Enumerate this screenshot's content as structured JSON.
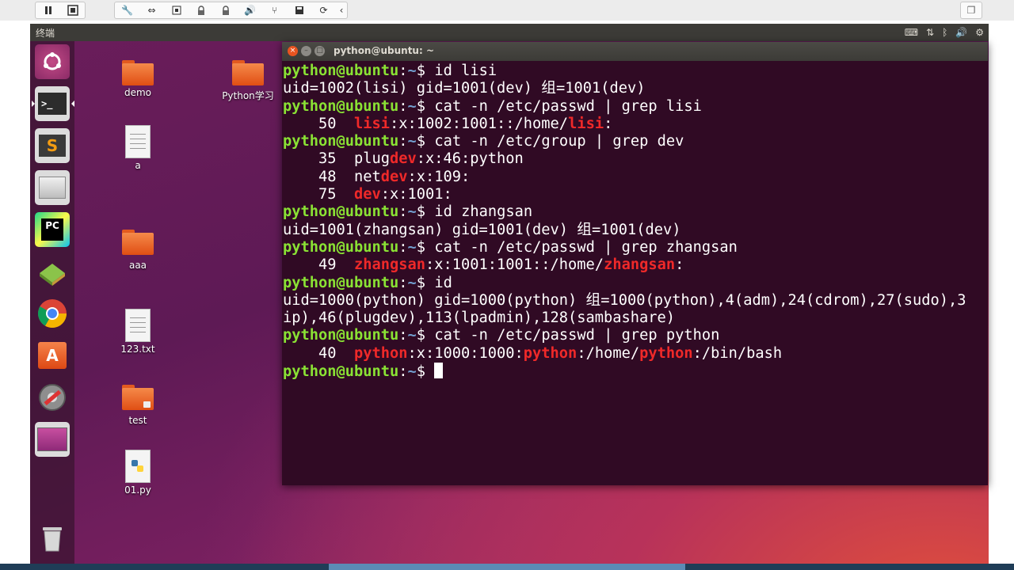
{
  "vm_toolbar": {
    "buttons": [
      "pause",
      "snapshot",
      "settings",
      "connect",
      "keyboard",
      "lock1",
      "lock2",
      "volume",
      "usb",
      "save",
      "refresh",
      "collapse"
    ]
  },
  "top_panel": {
    "title": "终端",
    "indicators": [
      "keyboard-icon",
      "network-icon",
      "bluetooth-icon",
      "volume-icon",
      "settings-icon"
    ]
  },
  "launcher": {
    "items": [
      "ubuntu-dash",
      "terminal",
      "sublime-text",
      "files",
      "pycharm",
      "books",
      "chrome",
      "software-center",
      "system-settings",
      "workspace-switcher",
      "trash"
    ]
  },
  "desktop_icons": [
    {
      "label": "demo",
      "type": "folder"
    },
    {
      "label": "Python学习",
      "type": "folder"
    },
    {
      "label": "a",
      "type": "document"
    },
    {
      "label": "aaa",
      "type": "folder"
    },
    {
      "label": "123.txt",
      "type": "document"
    },
    {
      "label": "test",
      "type": "folder-locked"
    },
    {
      "label": "01.py",
      "type": "python-file"
    }
  ],
  "terminal": {
    "title": "python@ubuntu: ~",
    "prompt_user": "python@ubuntu",
    "prompt_path": "~",
    "lines": [
      {
        "kind": "cmd",
        "text": "id lisi"
      },
      {
        "kind": "out",
        "segments": [
          {
            "t": "uid=1002(lisi) gid=1001(dev) 组=1001(dev)"
          }
        ]
      },
      {
        "kind": "cmd",
        "text": "cat -n /etc/passwd | grep lisi"
      },
      {
        "kind": "out",
        "segments": [
          {
            "t": "    50  "
          },
          {
            "t": "lisi",
            "h": true
          },
          {
            "t": ":x:1002:1001::/home/"
          },
          {
            "t": "lisi",
            "h": true
          },
          {
            "t": ":"
          }
        ]
      },
      {
        "kind": "cmd",
        "text": "cat -n /etc/group | grep dev"
      },
      {
        "kind": "out",
        "segments": [
          {
            "t": "    35  plug"
          },
          {
            "t": "dev",
            "h": true
          },
          {
            "t": ":x:46:python"
          }
        ]
      },
      {
        "kind": "out",
        "segments": [
          {
            "t": "    48  net"
          },
          {
            "t": "dev",
            "h": true
          },
          {
            "t": ":x:109:"
          }
        ]
      },
      {
        "kind": "out",
        "segments": [
          {
            "t": "    75  "
          },
          {
            "t": "dev",
            "h": true
          },
          {
            "t": ":x:1001:"
          }
        ]
      },
      {
        "kind": "cmd",
        "text": "id zhangsan"
      },
      {
        "kind": "out",
        "segments": [
          {
            "t": "uid=1001(zhangsan) gid=1001(dev) 组=1001(dev)"
          }
        ]
      },
      {
        "kind": "cmd",
        "text": "cat -n /etc/passwd | grep zhangsan"
      },
      {
        "kind": "out",
        "segments": [
          {
            "t": "    49  "
          },
          {
            "t": "zhangsan",
            "h": true
          },
          {
            "t": ":x:1001:1001::/home/"
          },
          {
            "t": "zhangsan",
            "h": true
          },
          {
            "t": ":"
          }
        ]
      },
      {
        "kind": "cmd",
        "text": "id"
      },
      {
        "kind": "out",
        "segments": [
          {
            "t": "uid=1000(python) gid=1000(python) 组=1000(python),4(adm),24(cdrom),27(sudo),3"
          }
        ]
      },
      {
        "kind": "out",
        "segments": [
          {
            "t": "ip),46(plugdev),113(lpadmin),128(sambashare)"
          }
        ]
      },
      {
        "kind": "cmd",
        "text": "cat -n /etc/passwd | grep python"
      },
      {
        "kind": "out",
        "segments": [
          {
            "t": "    40  "
          },
          {
            "t": "python",
            "h": true
          },
          {
            "t": ":x:1000:1000:"
          },
          {
            "t": "python",
            "h": true
          },
          {
            "t": ":/home/"
          },
          {
            "t": "python",
            "h": true
          },
          {
            "t": ":/bin/bash"
          }
        ]
      },
      {
        "kind": "prompt",
        "text": ""
      }
    ]
  }
}
